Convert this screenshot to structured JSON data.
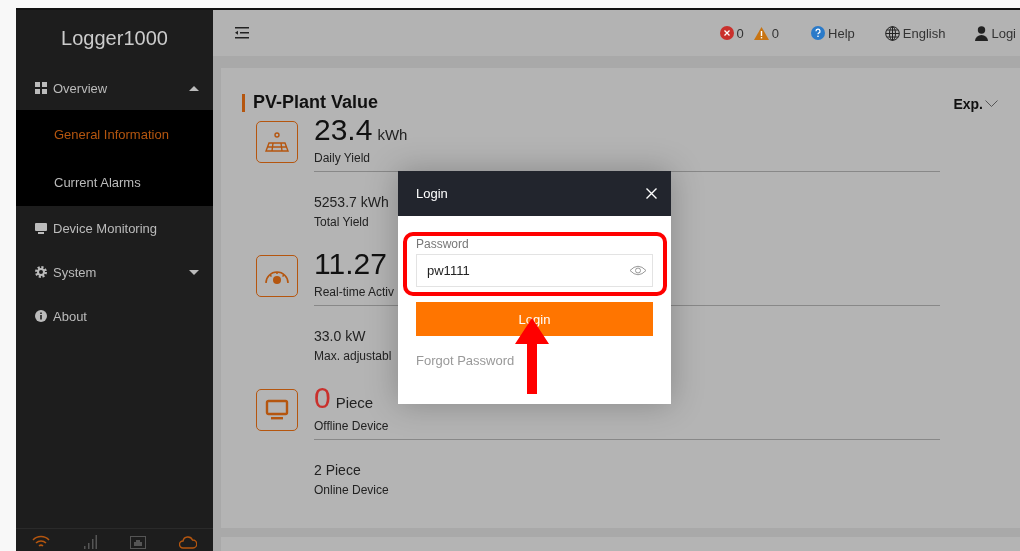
{
  "sidebar": {
    "title": "Logger1000",
    "items": [
      {
        "label": "Overview",
        "kind": "grid",
        "expanded": true,
        "children": [
          {
            "label": "General Information",
            "selected": true
          },
          {
            "label": "Current Alarms",
            "selected": false
          }
        ]
      },
      {
        "label": "Device Monitoring",
        "kind": "monitor",
        "selected": false
      },
      {
        "label": "System",
        "kind": "gear",
        "expanded": false
      },
      {
        "label": "About",
        "kind": "info",
        "selected": false
      }
    ],
    "status_icons": [
      {
        "kind": "wifi",
        "color": "#b5560f"
      },
      {
        "kind": "signal",
        "color": "#555555"
      },
      {
        "kind": "ethernet",
        "color": "#555555"
      },
      {
        "kind": "cloud",
        "color": "#b5560f"
      }
    ]
  },
  "header": {
    "error_count": "0",
    "warning_count": "0",
    "help": "Help",
    "language": "English",
    "login": "Logi"
  },
  "card": {
    "title": "PV-Plant Value",
    "export": "Exp.",
    "groups": [
      {
        "kind": "solar",
        "primary": {
          "value": "23.4",
          "unit": "kWh",
          "label": "Daily Yield",
          "alert": false
        },
        "secondary": {
          "value": "5253.7 kWh",
          "label": "Total Yield"
        }
      },
      {
        "kind": "gauge",
        "primary": {
          "value": "11.27",
          "label": "Real-time Activ",
          "alert": false
        },
        "secondary": {
          "value": "33.0 kW",
          "label": "Max. adjustabl"
        }
      },
      {
        "kind": "monitor",
        "primary": {
          "value": "0",
          "unit": "Piece",
          "label": "Offline Device",
          "alert": true
        },
        "secondary": {
          "value": "2 Piece",
          "label": "Online Device"
        }
      }
    ]
  },
  "dialog": {
    "title": "Login",
    "field_label": "Password",
    "password": "pw1111",
    "button": "Login",
    "forgot": "Forgot Password"
  }
}
